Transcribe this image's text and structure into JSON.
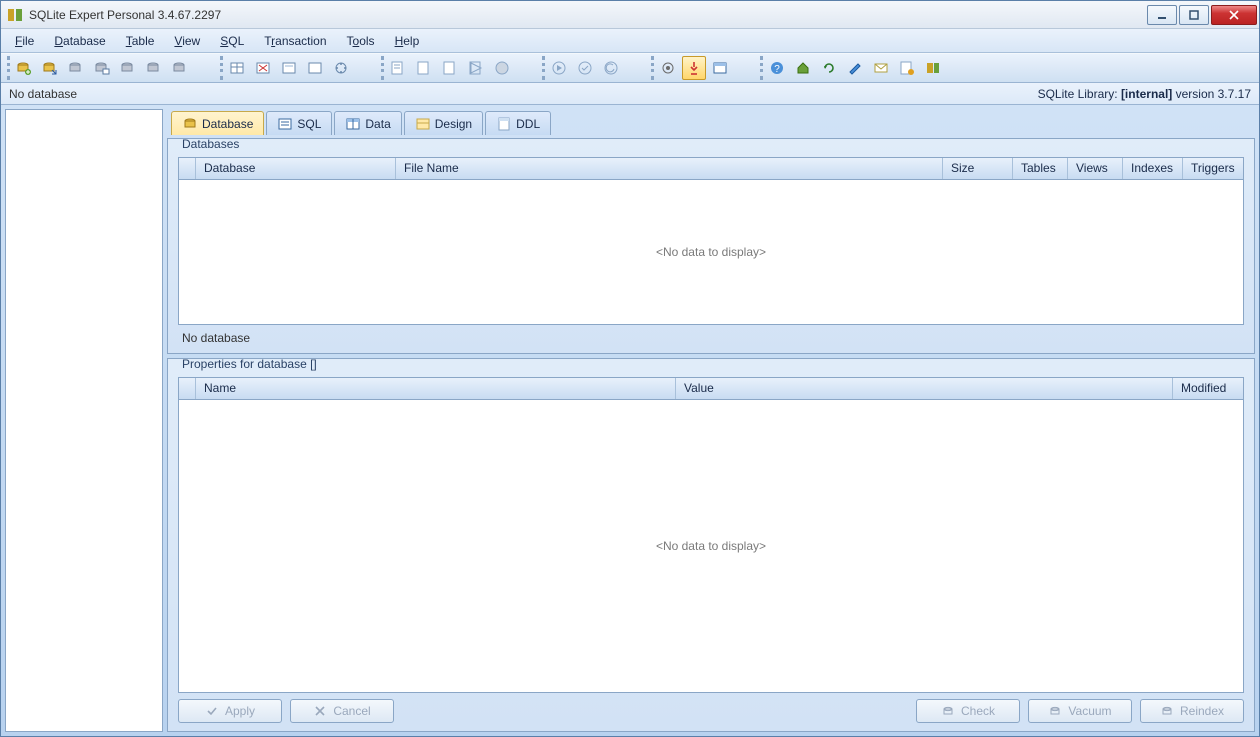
{
  "title": "SQLite Expert Personal 3.4.67.2297",
  "menu": [
    "File",
    "Database",
    "Table",
    "View",
    "SQL",
    "Transaction",
    "Tools",
    "Help"
  ],
  "status_left": "No database",
  "status_lib_prefix": "SQLite Library: ",
  "status_lib_bold": "[internal]",
  "status_lib_suffix": " version 3.7.17",
  "tabs": [
    {
      "label": "Database",
      "active": true
    },
    {
      "label": "SQL",
      "active": false
    },
    {
      "label": "Data",
      "active": false
    },
    {
      "label": "Design",
      "active": false
    },
    {
      "label": "DDL",
      "active": false
    }
  ],
  "databases": {
    "legend": "Databases",
    "columns": [
      "Database",
      "File Name",
      "Size",
      "Tables",
      "Views",
      "Indexes",
      "Triggers"
    ],
    "empty_text": "<No data to display>",
    "footer": "No database"
  },
  "properties": {
    "legend": "Properties for database []",
    "columns": [
      "Name",
      "Value",
      "Modified"
    ],
    "empty_text": "<No data to display>"
  },
  "buttons": {
    "apply": "Apply",
    "cancel": "Cancel",
    "check": "Check",
    "vacuum": "Vacuum",
    "reindex": "Reindex"
  }
}
